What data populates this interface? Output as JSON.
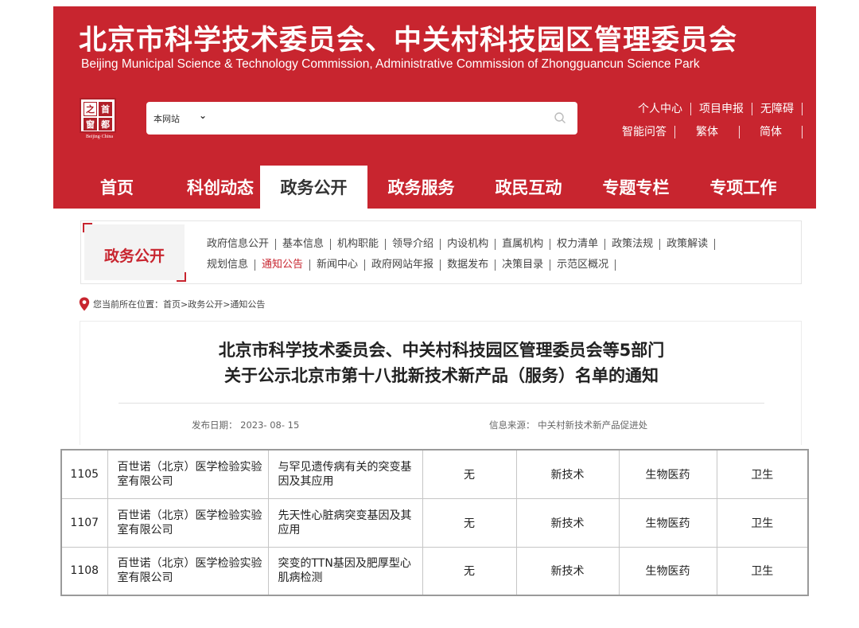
{
  "header": {
    "title_cn": "北京市科学技术委员会、中关村科技园区管理委员会",
    "title_en": "Beijing Municipal Science & Technology Commission, Administrative Commission of Zhongguancun Science Park",
    "logo": {
      "chars": [
        "之",
        "首",
        "窗",
        "都"
      ],
      "subtitle": "Beijing·China"
    },
    "search": {
      "scope": "本网站",
      "scope_icon": "chevron-down-icon",
      "icon": "search-icon"
    },
    "top_links_row1": [
      "个人中心",
      "项目申报",
      "无障碍"
    ],
    "top_links_row2": [
      "智能问答",
      "繁体",
      "简体"
    ]
  },
  "nav": [
    {
      "label": "首页"
    },
    {
      "label": "科创动态"
    },
    {
      "label": "政务公开",
      "active": true
    },
    {
      "label": "政务服务"
    },
    {
      "label": "政民互动"
    },
    {
      "label": "专题专栏"
    },
    {
      "label": "专项工作"
    }
  ],
  "subnav": {
    "title": "政务公开",
    "row1": [
      "政府信息公开",
      "基本信息",
      "机构职能",
      "领导介绍",
      "内设机构",
      "直属机构",
      "权力清单",
      "政策法规",
      "政策解读"
    ],
    "row2": [
      "规划信息",
      "通知公告",
      "新闻中心",
      "政府网站年报",
      "数据发布",
      "决策目录",
      "示范区概况"
    ],
    "active": "通知公告"
  },
  "breadcrumb": {
    "text": "您当前所在位置：首页>政务公开>通知公告"
  },
  "article": {
    "title_line1": "北京市科学技术委员会、中关村科技园区管理委员会等5部门",
    "title_line2": "关于公示北京市第十八批新技术新产品（服务）名单的通知",
    "date_label": "发布日期：",
    "date": "2023- 08- 15",
    "source_label": "信息来源：",
    "source": "中关村新技术新产品促进处"
  },
  "table": {
    "rows": [
      {
        "no": "1105",
        "org": "百世诺（北京）医学检验实验室有限公司",
        "name": "与罕见遗传病有关的突变基因及其应用",
        "c3": "无",
        "c4": "新技术",
        "c5": "生物医药",
        "c6": "卫生"
      },
      {
        "no": "1107",
        "org": "百世诺（北京）医学检验实验室有限公司",
        "name": "先天性心脏病突变基因及其应用",
        "c3": "无",
        "c4": "新技术",
        "c5": "生物医药",
        "c6": "卫生"
      },
      {
        "no": "1108",
        "org": "百世诺（北京）医学检验实验室有限公司",
        "name": "突变的TTN基因及肥厚型心肌病检测",
        "c3": "无",
        "c4": "新技术",
        "c5": "生物医药",
        "c6": "卫生"
      }
    ]
  },
  "colors": {
    "brand_red": "#c8252f",
    "active_link": "#c8252f"
  }
}
